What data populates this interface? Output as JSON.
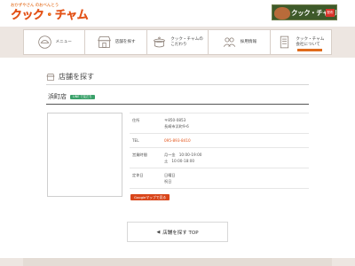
{
  "header": {
    "logo_tagline": "おかずやさん のおべんとう",
    "logo_main": "クック",
    "logo_dot": "・",
    "logo_main2": "チャム",
    "banner_text": "クック・チャムDM",
    "banner_badge": "配布"
  },
  "nav": {
    "items": [
      {
        "label": "メニュー",
        "icon": "rice-bowl-icon"
      },
      {
        "label": "店舗を探す",
        "icon": "shop-icon"
      },
      {
        "label": "クック・チャムの\nこだわり",
        "icon": "pot-icon"
      },
      {
        "label": "採用情報",
        "icon": "people-icon"
      },
      {
        "label": "クック・チャム\n会社について",
        "icon": "document-icon"
      }
    ]
  },
  "page": {
    "heading": "店舗を探す",
    "store_name": "浜町店",
    "store_badge": "LINE で友だち"
  },
  "info": {
    "rows": [
      {
        "label": "住所",
        "lines": [
          "〒850-0853",
          "長崎市浜町9-6"
        ]
      },
      {
        "label": "TEL",
        "lines": [
          "095-893-8410"
        ]
      },
      {
        "label": "営業時間",
        "lines": [
          "月～金　10:00-19:00",
          "土　10:00-18:00"
        ]
      },
      {
        "label": "定休日",
        "lines": [
          "日曜日",
          "祝日"
        ]
      }
    ],
    "gmap_button": "Googleマップで見る"
  },
  "back": {
    "arrow": "◀",
    "label": "店舗を探す TOP"
  },
  "colors": {
    "accent": "#e3541a",
    "nav_bg": "#ede6e1",
    "badge_green": "#3aa16a"
  }
}
